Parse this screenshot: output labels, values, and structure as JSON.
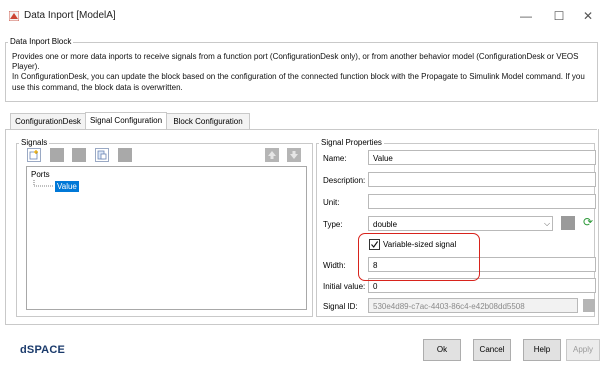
{
  "window": {
    "title": "Data Inport [ModelA]",
    "minimize": "—",
    "maximize": "☐",
    "close": "✕"
  },
  "block_group": {
    "legend": "Data Inport Block",
    "description": "Provides one or more data inports to receive signals from a function port (ConfigurationDesk only), or from another behavior model (ConfigurationDesk or VEOS Player).\nIn ConfigurationDesk, you can update the block based on the configuration of the connected function block with the Propagate to Simulink Model command. If you use this command, the block data is overwritten."
  },
  "tabs": [
    {
      "label": "ConfigurationDesk",
      "active": false
    },
    {
      "label": "Signal Configuration",
      "active": true
    },
    {
      "label": "Block Configuration",
      "active": false
    }
  ],
  "signals": {
    "legend": "Signals",
    "tree_root": "Ports",
    "tree_item": "Value"
  },
  "properties": {
    "legend": "Signal Properties",
    "name_label": "Name:",
    "name_value": "Value",
    "description_label": "Description:",
    "description_value": "",
    "unit_label": "Unit:",
    "unit_value": "",
    "type_label": "Type:",
    "type_value": "double",
    "variable_label": "Variable-sized signal",
    "variable_checked": true,
    "width_label": "Width:",
    "width_value": "8",
    "initial_label": "Initial value:",
    "initial_value": "0",
    "signal_id_label": "Signal ID:",
    "signal_id_value": "530e4d89-c7ac-4403-86c4-e42b08dd5508"
  },
  "footer": {
    "brand": "dSPACE",
    "ok": "Ok",
    "cancel": "Cancel",
    "help": "Help",
    "apply": "Apply"
  },
  "colors": {
    "accent": "#0078d7",
    "highlight": "#d8231c",
    "brand": "#1a3a6b"
  }
}
